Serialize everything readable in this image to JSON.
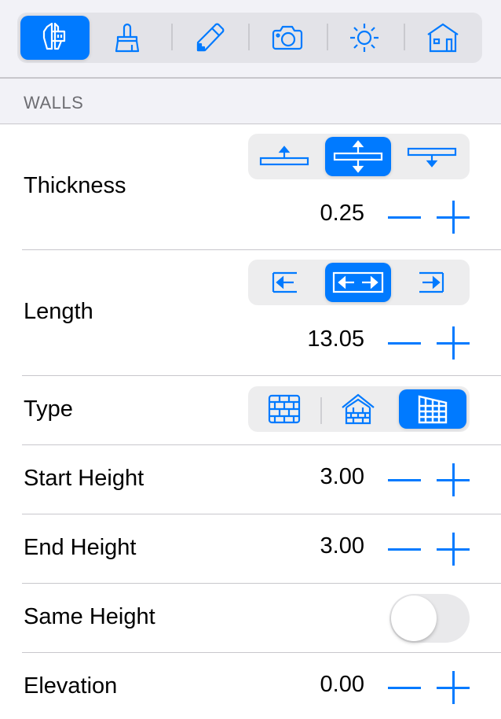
{
  "toolbar": {
    "items": [
      {
        "name": "measure",
        "icon": "caliper-icon",
        "selected": true
      },
      {
        "name": "paint",
        "icon": "brush-icon",
        "selected": false
      },
      {
        "name": "edit",
        "icon": "pencil-icon",
        "selected": false
      },
      {
        "name": "camera",
        "icon": "camera-icon",
        "selected": false
      },
      {
        "name": "light",
        "icon": "sun-icon",
        "selected": false
      },
      {
        "name": "building",
        "icon": "house-icon",
        "selected": false
      }
    ]
  },
  "section": {
    "title": "WALLS"
  },
  "thickness": {
    "label": "Thickness",
    "value": "0.25",
    "options": [
      "align-top-icon",
      "align-center-icon",
      "align-bottom-icon"
    ],
    "selected_index": 1
  },
  "length": {
    "label": "Length",
    "value": "13.05",
    "options": [
      "extend-left-icon",
      "extend-both-icon",
      "extend-right-icon"
    ],
    "selected_index": 1
  },
  "type": {
    "label": "Type",
    "options": [
      "brick-wall-icon",
      "gable-wall-icon",
      "sloped-wall-icon"
    ],
    "selected_index": 2
  },
  "start_height": {
    "label": "Start Height",
    "value": "3.00"
  },
  "end_height": {
    "label": "End Height",
    "value": "3.00"
  },
  "same_height": {
    "label": "Same Height",
    "on": false
  },
  "elevation": {
    "label": "Elevation",
    "value": "0.00"
  },
  "colors": {
    "accent": "#007aff",
    "background": "#f2f2f7",
    "separator": "#c8c7cc"
  }
}
